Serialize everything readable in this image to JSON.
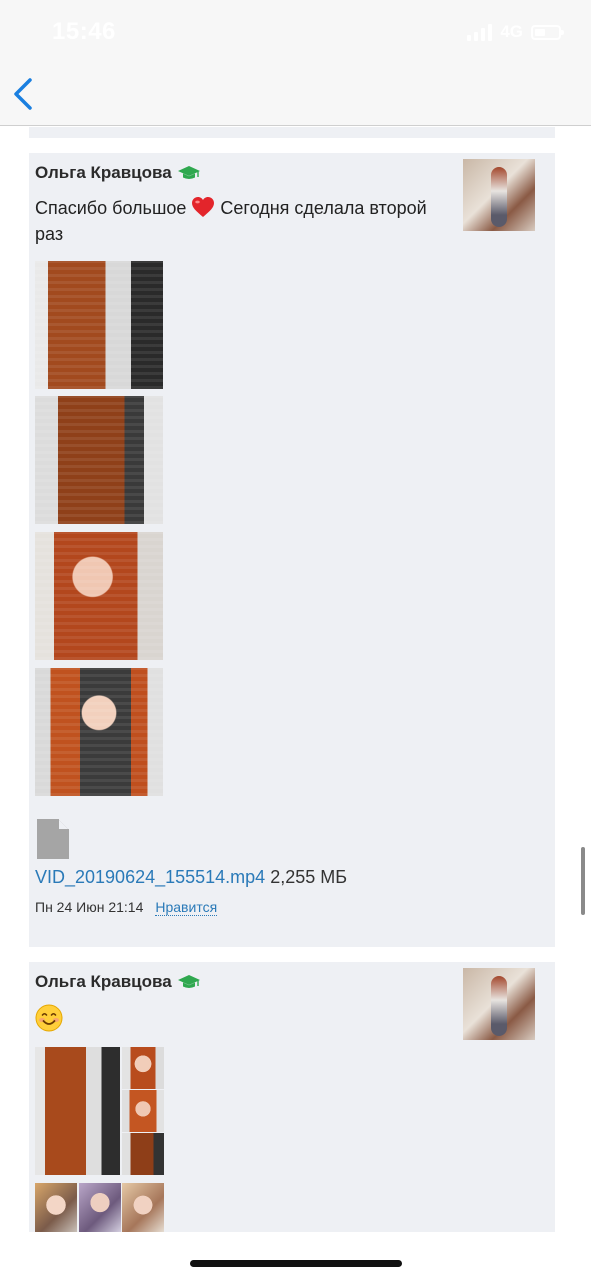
{
  "status_bar": {
    "time": "15:46",
    "network": "4G"
  },
  "nav": {
    "back_icon": "chevron-left-icon"
  },
  "posts": [
    {
      "author": "Ольга Кравцова",
      "author_badge_icon": "graduation-cap-icon",
      "message_before_emoji": "Спасибо большое",
      "message_emoji_icon": "red-heart-icon",
      "message_after_emoji": " Сегодня сделала второй раз",
      "photos_count_shown": 4,
      "attachment": {
        "icon": "file-icon",
        "filename": "VID_20190624_155514.mp4",
        "size": " 2,255 МБ"
      },
      "date": "Пн 24 Июн 21:14",
      "like_label": "Нравится"
    },
    {
      "author": "Ольга Кравцова",
      "author_badge_icon": "graduation-cap-icon",
      "message_emoji_icon": "smiling-face-icon"
    }
  ],
  "colors": {
    "link": "#2a7ab8",
    "card_background": "#eef0f4",
    "nav_accent": "#1a7fe0",
    "badge_green": "#2fa84f"
  }
}
